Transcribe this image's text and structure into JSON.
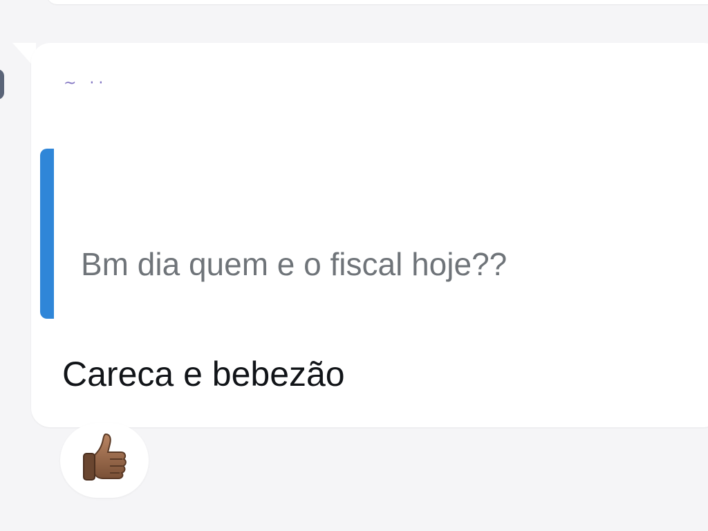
{
  "message": {
    "sender_name": "~ ··",
    "quoted_text": "Bm dia quem e o fiscal hoje??",
    "reply_text": "Careca e bebezão",
    "reaction": {
      "icon": "thumbs-up-icon",
      "emoji": "👍🏽"
    }
  },
  "colors": {
    "background": "#f5f5f7",
    "bubble": "#ffffff",
    "quote_bar": "#2f86d8",
    "sender_name": "#6b5bb8",
    "quoted_text": "#6f7479",
    "reply_text": "#111418"
  }
}
